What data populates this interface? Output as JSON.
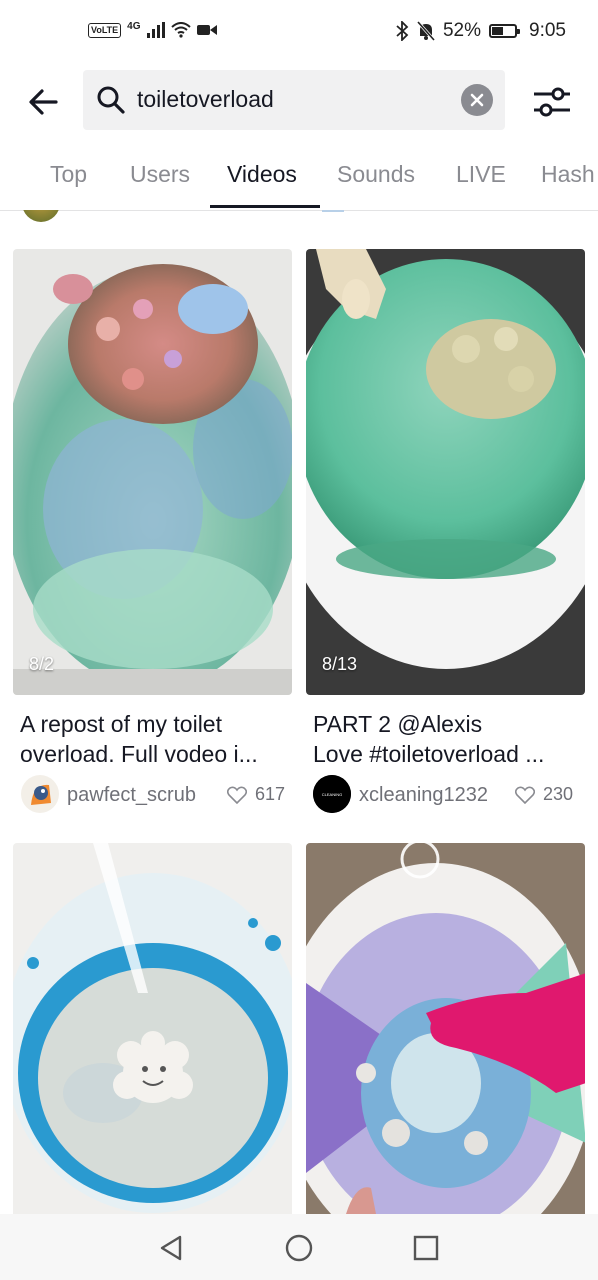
{
  "status": {
    "network": "4G",
    "volte": "VoLTE",
    "battery": "52%",
    "battery_level": 0.52,
    "time": "9:05"
  },
  "search": {
    "query": "toiletoverload"
  },
  "tabs": [
    {
      "label": "Top"
    },
    {
      "label": "Users"
    },
    {
      "label": "Videos",
      "active": true
    },
    {
      "label": "Sounds"
    },
    {
      "label": "LIVE"
    },
    {
      "label": "Hash"
    }
  ],
  "videos": [
    {
      "date": "8/2",
      "caption_line1": "A repost of my toilet",
      "caption_line2": "overload.  Full vodeo i...",
      "username": "pawfect_scrub",
      "likes": "617"
    },
    {
      "date": "8/13",
      "caption_line1": "PART 2 @Alexis",
      "caption_line2": "Love #toiletoverload ...",
      "username": "xcleaning1232",
      "likes": "230",
      "avatar_text": "CLEANING"
    },
    {
      "date": ""
    },
    {
      "date": ""
    }
  ],
  "colors": {
    "text": "#161823",
    "muted": "#8a8b91",
    "pink_glove": "#e0186e"
  }
}
